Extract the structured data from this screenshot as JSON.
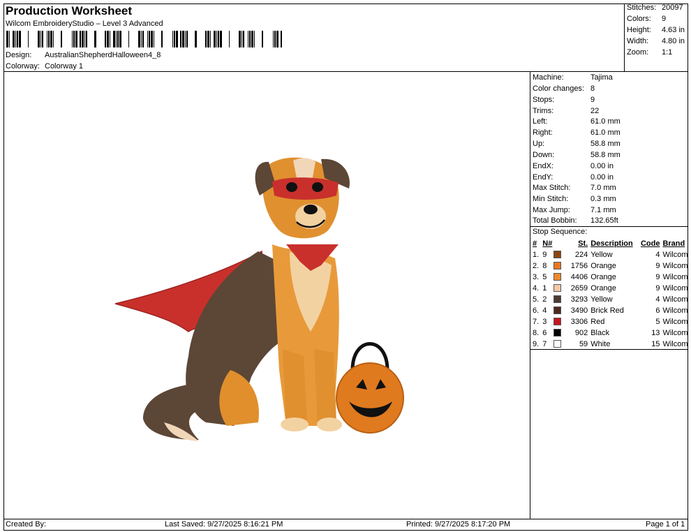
{
  "header": {
    "title": "Production Worksheet",
    "subtitle": "Wilcom EmbroideryStudio – Level 3 Advanced",
    "design_label": "Design:",
    "design_value": "AustralianShepherdHalloween4_8",
    "colorway_label": "Colorway:",
    "colorway_value": "Colorway 1"
  },
  "summary": [
    {
      "label": "Stitches:",
      "value": "20097"
    },
    {
      "label": "Colors:",
      "value": "9"
    },
    {
      "label": "Height:",
      "value": "4.63 in"
    },
    {
      "label": "Width:",
      "value": "4.80 in"
    },
    {
      "label": "Zoom:",
      "value": "1:1"
    }
  ],
  "machine_info": [
    {
      "label": "Machine:",
      "value": "Tajima"
    },
    {
      "label": "Color changes:",
      "value": "8"
    },
    {
      "label": "Stops:",
      "value": "9"
    },
    {
      "label": "Trims:",
      "value": "22"
    },
    {
      "label": "Left:",
      "value": "61.0 mm"
    },
    {
      "label": "Right:",
      "value": "61.0 mm"
    },
    {
      "label": "Up:",
      "value": "58.8 mm"
    },
    {
      "label": "Down:",
      "value": "58.8 mm"
    },
    {
      "label": "EndX:",
      "value": "0.00 in"
    },
    {
      "label": "EndY:",
      "value": "0.00 in"
    },
    {
      "label": "Max Stitch:",
      "value": "7.0 mm"
    },
    {
      "label": "Min Stitch:",
      "value": "0.3 mm"
    },
    {
      "label": "Max Jump:",
      "value": "7.1 mm"
    },
    {
      "label": "Total Bobbin:",
      "value": "132.65ft"
    }
  ],
  "stop_sequence": {
    "title": "Stop Sequence:",
    "headers": [
      "#",
      "N#",
      "St.",
      "Description",
      "Code",
      "Brand"
    ],
    "rows": [
      {
        "num": "1.",
        "n": "9",
        "color": "#8B4513",
        "st": "224",
        "desc": "Yellow",
        "code": "4",
        "brand": "Wilcom"
      },
      {
        "num": "2.",
        "n": "8",
        "color": "#E87722",
        "st": "1756",
        "desc": "Orange",
        "code": "9",
        "brand": "Wilcom"
      },
      {
        "num": "3.",
        "n": "5",
        "color": "#F08A2C",
        "st": "4406",
        "desc": "Orange",
        "code": "9",
        "brand": "Wilcom"
      },
      {
        "num": "4.",
        "n": "1",
        "color": "#F3C9A6",
        "st": "2659",
        "desc": "Orange",
        "code": "9",
        "brand": "Wilcom"
      },
      {
        "num": "5.",
        "n": "2",
        "color": "#4A3C33",
        "st": "3293",
        "desc": "Yellow",
        "code": "4",
        "brand": "Wilcom"
      },
      {
        "num": "6.",
        "n": "4",
        "color": "#4E2A1E",
        "st": "3490",
        "desc": "Brick Red",
        "code": "6",
        "brand": "Wilcom"
      },
      {
        "num": "7.",
        "n": "3",
        "color": "#C8161D",
        "st": "3306",
        "desc": "Red",
        "code": "5",
        "brand": "Wilcom"
      },
      {
        "num": "8.",
        "n": "6",
        "color": "#000000",
        "st": "902",
        "desc": "Black",
        "code": "13",
        "brand": "Wilcom"
      },
      {
        "num": "9.",
        "n": "7",
        "color": "#FFFFFF",
        "st": "59",
        "desc": "White",
        "code": "15",
        "brand": "Wilcom"
      }
    ]
  },
  "footer": {
    "created_by": "Created By:",
    "last_saved": "Last Saved: 9/27/2025 8:16:21 PM",
    "printed": "Printed: 9/27/2025 8:17:20 PM",
    "page": "Page 1 of 1"
  }
}
